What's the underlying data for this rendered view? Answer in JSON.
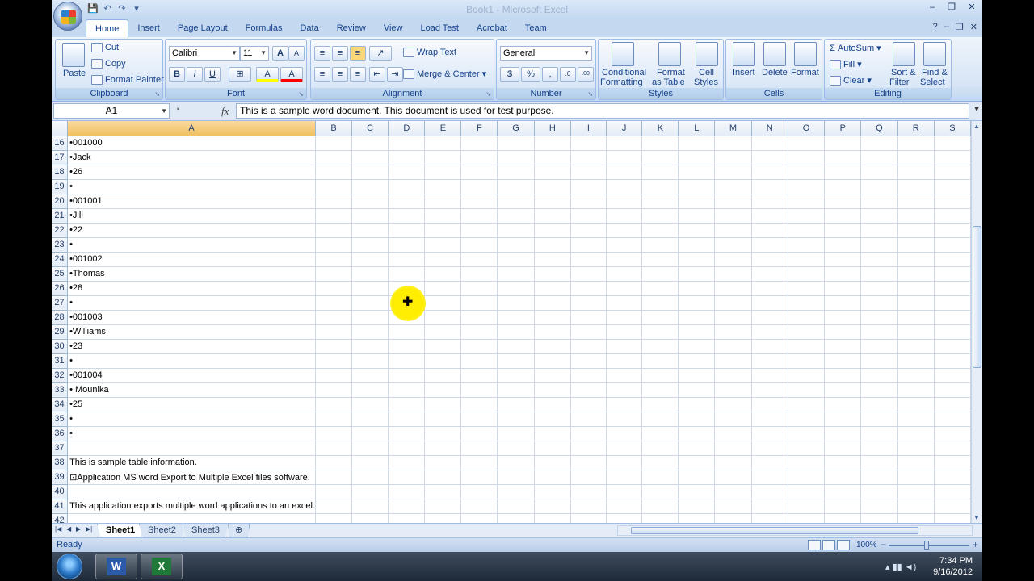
{
  "window": {
    "title": "Book1 - Microsoft Excel",
    "controls": {
      "minimize": "–",
      "restore": "❐",
      "close": "✕"
    },
    "ribbon_controls": {
      "help": "?",
      "minimize": "–",
      "restore": "❐",
      "close": "✕"
    }
  },
  "qat": {
    "save": "💾",
    "undo": "↶",
    "redo": "↷",
    "customize": "▾"
  },
  "tabs": [
    "Home",
    "Insert",
    "Page Layout",
    "Formulas",
    "Data",
    "Review",
    "View",
    "Load Test",
    "Acrobat",
    "Team"
  ],
  "ribbon": {
    "clipboard": {
      "label": "Clipboard",
      "paste": "Paste",
      "cut": "Cut",
      "copy": "Copy",
      "format_painter": "Format Painter"
    },
    "font": {
      "label": "Font",
      "name": "Calibri",
      "size": "11",
      "bold": "B",
      "italic": "I",
      "underline": "U",
      "grow": "A",
      "shrink": "A",
      "fill": "A",
      "color": "A"
    },
    "alignment": {
      "label": "Alignment",
      "wrap_text": "Wrap Text",
      "merge_center": "Merge & Center"
    },
    "number": {
      "label": "Number",
      "format": "General",
      "currency": "$",
      "percent": "%",
      "comma": ",",
      "inc_dec": ".0",
      "dec_dec": ".00"
    },
    "styles": {
      "label": "Styles",
      "conditional": "Conditional",
      "conditional2": "Formatting",
      "format_as": "Format",
      "format_as2": "as Table",
      "cell": "Cell",
      "cell2": "Styles"
    },
    "cells": {
      "label": "Cells",
      "insert": "Insert",
      "delete": "Delete",
      "format": "Format"
    },
    "editing": {
      "label": "Editing",
      "autosum": "AutoSum",
      "fill": "Fill",
      "clear": "Clear",
      "sort": "Sort &",
      "sort2": "Filter",
      "find": "Find &",
      "find2": "Select"
    }
  },
  "formula_bar": {
    "name_box": "A1",
    "fx": "fx",
    "content": "This is a sample word document. This document is used for test purpose."
  },
  "grid": {
    "columns": [
      "A",
      "B",
      "C",
      "D",
      "E",
      "F",
      "G",
      "H",
      "I",
      "J",
      "K",
      "L",
      "M",
      "N",
      "O",
      "P",
      "Q",
      "R",
      "S"
    ],
    "rows": [
      {
        "n": "16",
        "a": "•001000"
      },
      {
        "n": "17",
        "a": "•Jack"
      },
      {
        "n": "18",
        "a": "•26"
      },
      {
        "n": "19",
        "a": "•"
      },
      {
        "n": "20",
        "a": "•001001"
      },
      {
        "n": "21",
        "a": "•Jill"
      },
      {
        "n": "22",
        "a": "•22"
      },
      {
        "n": "23",
        "a": "•"
      },
      {
        "n": "24",
        "a": "•001002"
      },
      {
        "n": "25",
        "a": "•Thomas"
      },
      {
        "n": "26",
        "a": "•28"
      },
      {
        "n": "27",
        "a": "•"
      },
      {
        "n": "28",
        "a": "•001003"
      },
      {
        "n": "29",
        "a": "•Williams"
      },
      {
        "n": "30",
        "a": "•23"
      },
      {
        "n": "31",
        "a": "•"
      },
      {
        "n": "32",
        "a": "•001004"
      },
      {
        "n": "33",
        "a": "• Mounika"
      },
      {
        "n": "34",
        "a": "•25"
      },
      {
        "n": "35",
        "a": "•"
      },
      {
        "n": "36",
        "a": "•"
      },
      {
        "n": "37",
        "a": ""
      },
      {
        "n": "38",
        "a": "This is sample table information."
      },
      {
        "n": "39",
        "a": "⊡Application MS word Export to Multiple Excel files software."
      },
      {
        "n": "40",
        "a": ""
      },
      {
        "n": "41",
        "a": "This application exports multiple word applications  to an excel."
      },
      {
        "n": "42",
        "a": ""
      }
    ]
  },
  "sheets": {
    "tabs": [
      "Sheet1",
      "Sheet2",
      "Sheet3"
    ],
    "active": "Sheet1"
  },
  "status": {
    "text": "Ready",
    "zoom": "100%",
    "zoom_minus": "−",
    "zoom_plus": "+"
  },
  "taskbar": {
    "time": "7:34 PM",
    "date": "9/16/2012",
    "word_icon": "W",
    "excel_icon": "X"
  }
}
